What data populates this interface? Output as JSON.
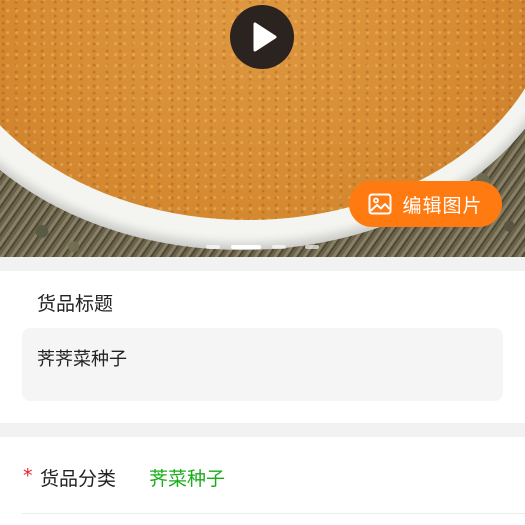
{
  "media": {
    "play_icon": "play-icon",
    "edit_button_label": "编辑图片",
    "edit_icon": "image-icon",
    "carousel_slide_count": 4,
    "carousel_active_index": 1
  },
  "title_section": {
    "label": "货品标题",
    "value": "荠荠菜种子"
  },
  "category_section": {
    "required_mark": "*",
    "label": "货品分类",
    "value": "荠菜种子"
  },
  "colors": {
    "accent_orange": "#ff7a10",
    "category_green": "#1aad19",
    "required_red": "#e8202a"
  }
}
